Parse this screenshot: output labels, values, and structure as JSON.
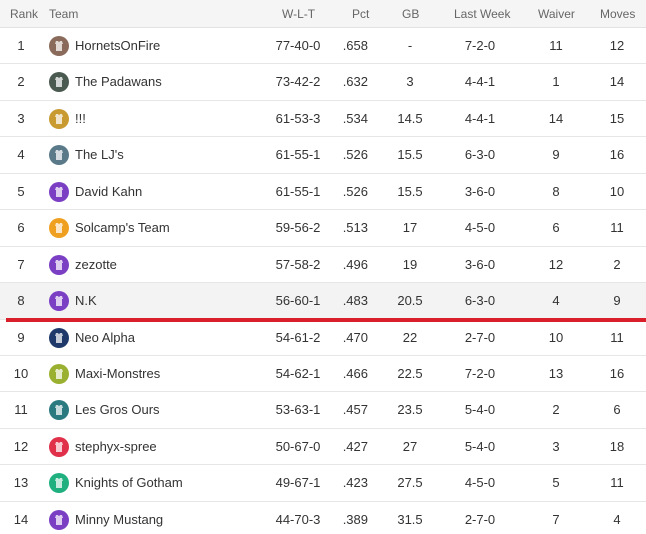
{
  "columns": {
    "rank": "Rank",
    "team": "Team",
    "wlt": "W-L-T",
    "pct": "Pct",
    "gb": "GB",
    "last_week": "Last Week",
    "waiver": "Waiver",
    "moves": "Moves"
  },
  "rows": [
    {
      "rank": "1",
      "team": "HornetsOnFire",
      "wlt": "77-40-0",
      "pct": ".658",
      "gb": "-",
      "last_week": "7-2-0",
      "waiver": "11",
      "moves": "12",
      "avatar_color": "#8a6a5a"
    },
    {
      "rank": "2",
      "team": "The Padawans",
      "wlt": "73-42-2",
      "pct": ".632",
      "gb": "3",
      "last_week": "4-4-1",
      "waiver": "1",
      "moves": "14",
      "avatar_color": "#4a5a50"
    },
    {
      "rank": "3",
      "team": "!!!",
      "wlt": "61-53-3",
      "pct": ".534",
      "gb": "14.5",
      "last_week": "4-4-1",
      "waiver": "14",
      "moves": "15",
      "avatar_color": "#c89a30"
    },
    {
      "rank": "4",
      "team": "The LJ's",
      "wlt": "61-55-1",
      "pct": ".526",
      "gb": "15.5",
      "last_week": "6-3-0",
      "waiver": "9",
      "moves": "16",
      "avatar_color": "#5a7a8a"
    },
    {
      "rank": "5",
      "team": "David Kahn",
      "wlt": "61-55-1",
      "pct": ".526",
      "gb": "15.5",
      "last_week": "3-6-0",
      "waiver": "8",
      "moves": "10",
      "avatar_color": "#7b3fc4"
    },
    {
      "rank": "6",
      "team": "Solcamp's Team",
      "wlt": "59-56-2",
      "pct": ".513",
      "gb": "17",
      "last_week": "4-5-0",
      "waiver": "6",
      "moves": "11",
      "avatar_color": "#f0a020"
    },
    {
      "rank": "7",
      "team": "zezotte",
      "wlt": "57-58-2",
      "pct": ".496",
      "gb": "19",
      "last_week": "3-6-0",
      "waiver": "12",
      "moves": "2",
      "avatar_color": "#7b3fc4"
    },
    {
      "rank": "8",
      "team": "N.K",
      "wlt": "56-60-1",
      "pct": ".483",
      "gb": "20.5",
      "last_week": "6-3-0",
      "waiver": "4",
      "moves": "9",
      "avatar_color": "#7b3fc4"
    },
    {
      "rank": "9",
      "team": "Neo Alpha",
      "wlt": "54-61-2",
      "pct": ".470",
      "gb": "22",
      "last_week": "2-7-0",
      "waiver": "10",
      "moves": "11",
      "avatar_color": "#1f3a6a"
    },
    {
      "rank": "10",
      "team": "Maxi-Monstres",
      "wlt": "54-62-1",
      "pct": ".466",
      "gb": "22.5",
      "last_week": "7-2-0",
      "waiver": "13",
      "moves": "16",
      "avatar_color": "#9ab030"
    },
    {
      "rank": "11",
      "team": "Les Gros Ours",
      "wlt": "53-63-1",
      "pct": ".457",
      "gb": "23.5",
      "last_week": "5-4-0",
      "waiver": "2",
      "moves": "6",
      "avatar_color": "#2a7a80"
    },
    {
      "rank": "12",
      "team": "stephyx-spree",
      "wlt": "50-67-0",
      "pct": ".427",
      "gb": "27",
      "last_week": "5-4-0",
      "waiver": "3",
      "moves": "18",
      "avatar_color": "#e0304a"
    },
    {
      "rank": "13",
      "team": "Knights of Gotham",
      "wlt": "49-67-1",
      "pct": ".423",
      "gb": "27.5",
      "last_week": "4-5-0",
      "waiver": "5",
      "moves": "11",
      "avatar_color": "#20b080"
    },
    {
      "rank": "14",
      "team": "Minny Mustang",
      "wlt": "44-70-3",
      "pct": ".389",
      "gb": "31.5",
      "last_week": "2-7-0",
      "waiver": "7",
      "moves": "4",
      "avatar_color": "#7b3fc4"
    }
  ],
  "highlighted_rank": "8",
  "playoff_cutline_color": "#d9202a"
}
